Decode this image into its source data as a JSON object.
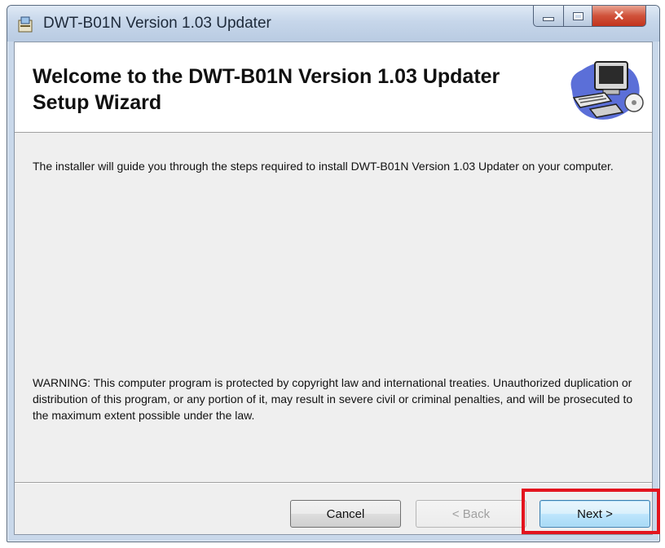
{
  "window": {
    "title": "DWT-B01N Version 1.03 Updater"
  },
  "title_controls": {
    "minimize_icon": "minimize-icon",
    "maximize_icon": "maximize-icon",
    "close_glyph": "✕"
  },
  "banner": {
    "title": "Welcome to the DWT-B01N Version 1.03 Updater Setup Wizard",
    "art_icon": "computer-setup-icon"
  },
  "content": {
    "intro": "The installer will guide you through the steps required to install DWT-B01N Version 1.03 Updater on your computer.",
    "warning": "WARNING: This computer program is protected by copyright law and international treaties. Unauthorized duplication or distribution of this program, or any portion of it, may result in severe civil or criminal penalties, and will be prosecuted to the maximum extent possible under the law."
  },
  "buttons": {
    "cancel": "Cancel",
    "back": "< Back",
    "next": "Next >"
  },
  "colors": {
    "highlight": "#e3141e",
    "title_bar": "#c6d6ea",
    "close_button": "#c2341d"
  }
}
